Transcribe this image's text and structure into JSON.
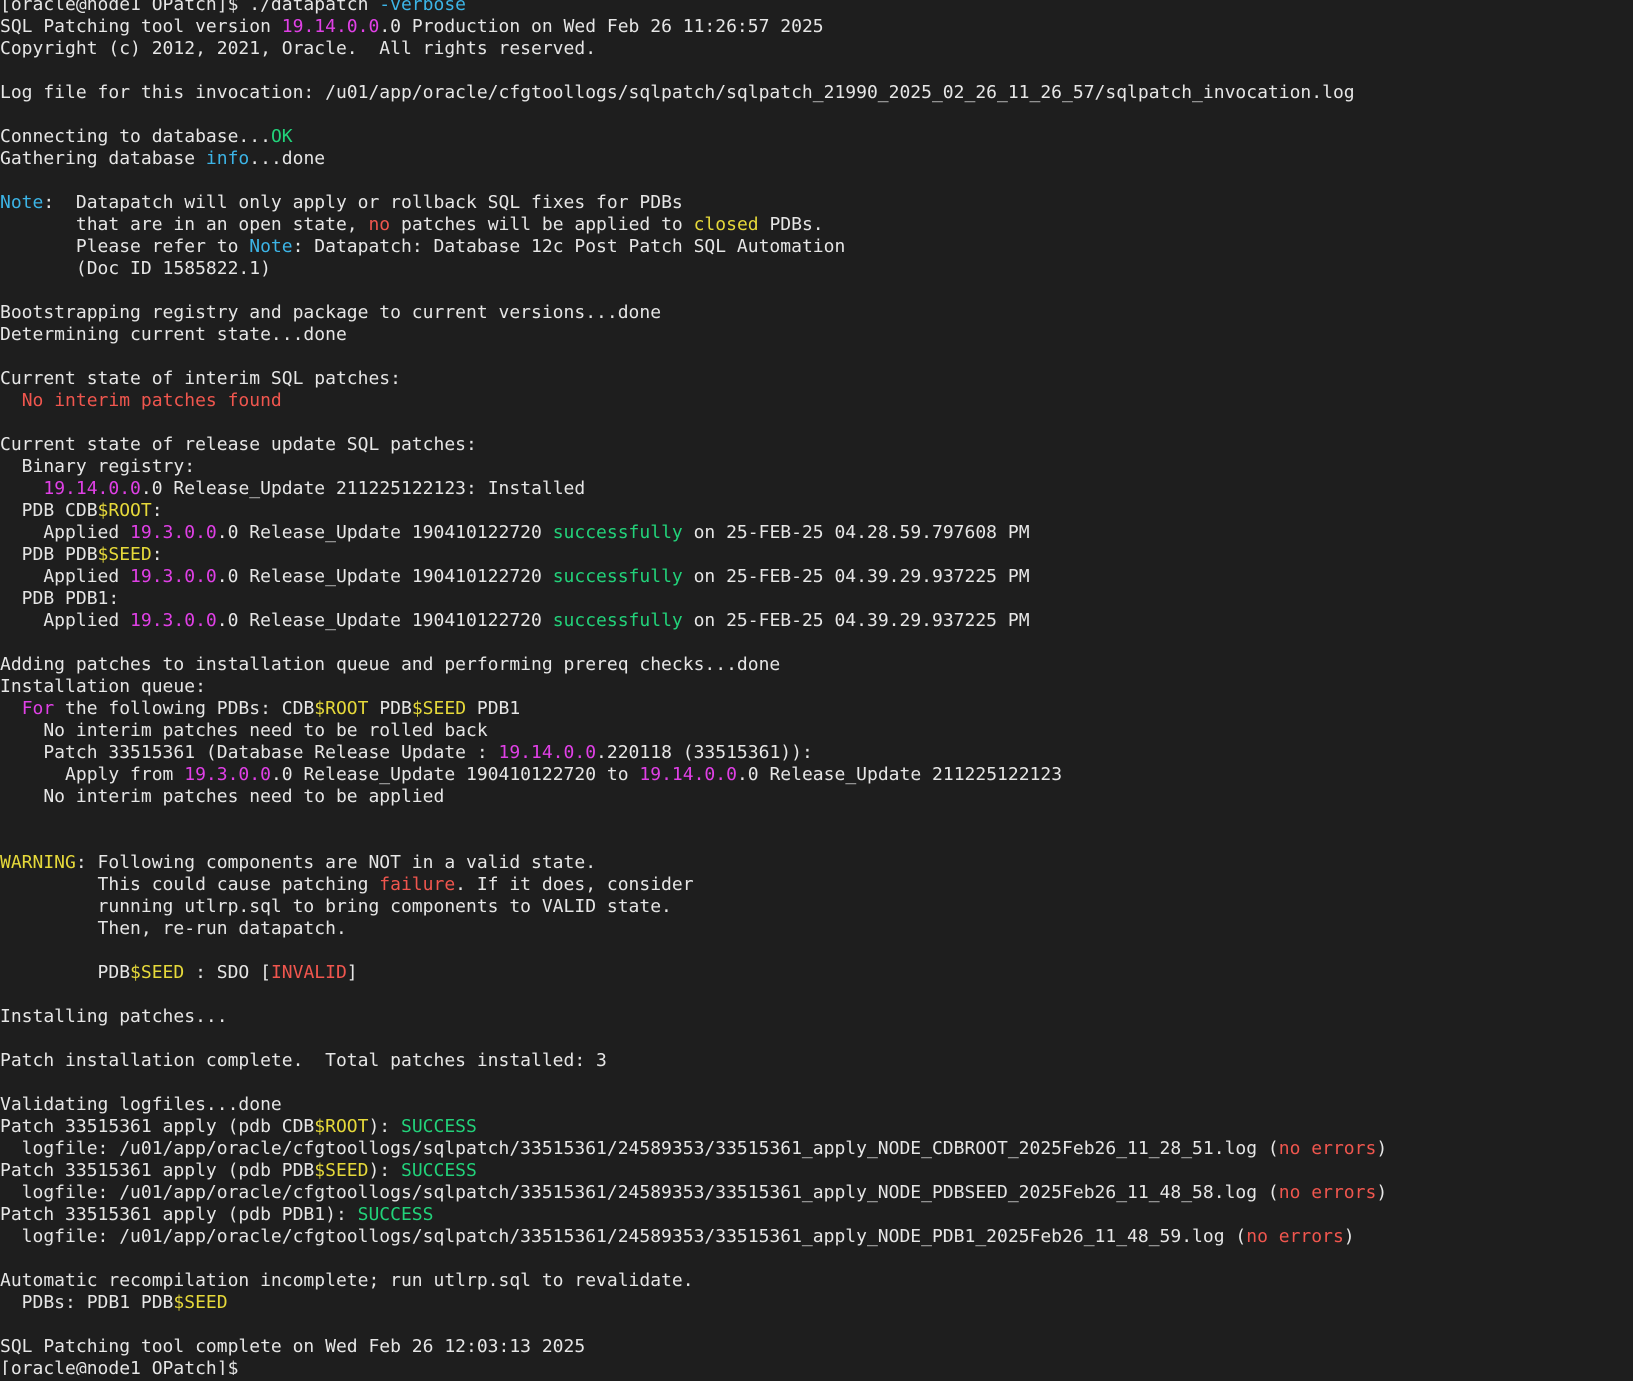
{
  "window": {
    "title": "Terminal - datapatch -verbose"
  },
  "palette": {
    "background": "#1e1e1e",
    "default": "#e6e6e6",
    "magenta": "#e040e6",
    "cyan": "#3cb4e6",
    "green": "#22d27a",
    "yellow": "#e6d93a",
    "red": "#f0564e"
  },
  "lines": [
    [
      [
        "[oracle@node1 OPatch]$ ./datapatch ",
        "default"
      ],
      [
        "-verbose",
        "cyan"
      ]
    ],
    [
      [
        "SQL Patching tool version ",
        "default"
      ],
      [
        "19.14.0.0",
        "magenta"
      ],
      [
        ".0 Production on Wed Feb 26 11:26:57 2025",
        "default"
      ]
    ],
    [
      [
        "Copyright (c) 2012, 2021, Oracle.  All rights reserved.",
        "default"
      ]
    ],
    [
      [
        "",
        "default"
      ]
    ],
    [
      [
        "Log file for this invocation: /u01/app/oracle/cfgtoollogs/sqlpatch/sqlpatch_21990_2025_02_26_11_26_57/sqlpatch_invocation.log",
        "default"
      ]
    ],
    [
      [
        "",
        "default"
      ]
    ],
    [
      [
        "Connecting to database...",
        "default"
      ],
      [
        "OK",
        "green"
      ]
    ],
    [
      [
        "Gathering database ",
        "default"
      ],
      [
        "info",
        "cyan"
      ],
      [
        "...done",
        "default"
      ]
    ],
    [
      [
        "",
        "default"
      ]
    ],
    [
      [
        "Note",
        "cyan"
      ],
      [
        ":  Datapatch will only apply or rollback SQL fixes for PDBs",
        "default"
      ]
    ],
    [
      [
        "       that are in an open state, ",
        "default"
      ],
      [
        "no",
        "red"
      ],
      [
        " patches will be applied to ",
        "default"
      ],
      [
        "closed",
        "yellow"
      ],
      [
        " PDBs.",
        "default"
      ]
    ],
    [
      [
        "       Please refer to ",
        "default"
      ],
      [
        "Note",
        "cyan"
      ],
      [
        ": Datapatch: Database 12c Post Patch SQL Automation",
        "default"
      ]
    ],
    [
      [
        "       (Doc ID 1585822.1)",
        "default"
      ]
    ],
    [
      [
        "",
        "default"
      ]
    ],
    [
      [
        "Bootstrapping registry and package to current versions...done",
        "default"
      ]
    ],
    [
      [
        "Determining current state...done",
        "default"
      ]
    ],
    [
      [
        "",
        "default"
      ]
    ],
    [
      [
        "Current state of interim SQL patches:",
        "default"
      ]
    ],
    [
      [
        "  ",
        "default"
      ],
      [
        "No interim patches found",
        "red"
      ]
    ],
    [
      [
        "",
        "default"
      ]
    ],
    [
      [
        "Current state of release update SQL patches:",
        "default"
      ]
    ],
    [
      [
        "  Binary registry:",
        "default"
      ]
    ],
    [
      [
        "    ",
        "default"
      ],
      [
        "19.14.0.0",
        "magenta"
      ],
      [
        ".0 Release_Update 211225122123: Installed",
        "default"
      ]
    ],
    [
      [
        "  PDB CDB",
        "default"
      ],
      [
        "$ROOT",
        "yellow"
      ],
      [
        ":",
        "default"
      ]
    ],
    [
      [
        "    Applied ",
        "default"
      ],
      [
        "19.3.0.0",
        "magenta"
      ],
      [
        ".0 Release_Update 190410122720 ",
        "default"
      ],
      [
        "successfully",
        "green"
      ],
      [
        " on 25-FEB-25 04.28.59.797608 PM",
        "default"
      ]
    ],
    [
      [
        "  PDB PDB",
        "default"
      ],
      [
        "$SEED",
        "yellow"
      ],
      [
        ":",
        "default"
      ]
    ],
    [
      [
        "    Applied ",
        "default"
      ],
      [
        "19.3.0.0",
        "magenta"
      ],
      [
        ".0 Release_Update 190410122720 ",
        "default"
      ],
      [
        "successfully",
        "green"
      ],
      [
        " on 25-FEB-25 04.39.29.937225 PM",
        "default"
      ]
    ],
    [
      [
        "  PDB PDB1:",
        "default"
      ]
    ],
    [
      [
        "    Applied ",
        "default"
      ],
      [
        "19.3.0.0",
        "magenta"
      ],
      [
        ".0 Release_Update 190410122720 ",
        "default"
      ],
      [
        "successfully",
        "green"
      ],
      [
        " on 25-FEB-25 04.39.29.937225 PM",
        "default"
      ]
    ],
    [
      [
        "",
        "default"
      ]
    ],
    [
      [
        "Adding patches to installation queue and performing prereq checks...done",
        "default"
      ]
    ],
    [
      [
        "Installation queue:",
        "default"
      ]
    ],
    [
      [
        "  ",
        "default"
      ],
      [
        "For",
        "magenta"
      ],
      [
        " the following PDBs: CDB",
        "default"
      ],
      [
        "$ROOT",
        "yellow"
      ],
      [
        " PDB",
        "default"
      ],
      [
        "$SEED",
        "yellow"
      ],
      [
        " PDB1",
        "default"
      ]
    ],
    [
      [
        "    No interim patches need to be rolled back",
        "default"
      ]
    ],
    [
      [
        "    Patch 33515361 (Database Release Update : ",
        "default"
      ],
      [
        "19.14.0.0",
        "magenta"
      ],
      [
        ".220118 (33515361)):",
        "default"
      ]
    ],
    [
      [
        "      Apply from ",
        "default"
      ],
      [
        "19.3.0.0",
        "magenta"
      ],
      [
        ".0 Release_Update 190410122720 to ",
        "default"
      ],
      [
        "19.14.0.0",
        "magenta"
      ],
      [
        ".0 Release_Update 211225122123",
        "default"
      ]
    ],
    [
      [
        "    No interim patches need to be applied",
        "default"
      ]
    ],
    [
      [
        "",
        "default"
      ]
    ],
    [
      [
        "",
        "default"
      ]
    ],
    [
      [
        "WARNING",
        "yellow"
      ],
      [
        ": Following components are NOT in a valid state.",
        "default"
      ]
    ],
    [
      [
        "         This could cause patching ",
        "default"
      ],
      [
        "failure",
        "red"
      ],
      [
        ". If it does, consider",
        "default"
      ]
    ],
    [
      [
        "         running utlrp.sql to bring components to VALID state.",
        "default"
      ]
    ],
    [
      [
        "         Then, re-run datapatch.",
        "default"
      ]
    ],
    [
      [
        "",
        "default"
      ]
    ],
    [
      [
        "         PDB",
        "default"
      ],
      [
        "$SEED",
        "yellow"
      ],
      [
        " : SDO [",
        "default"
      ],
      [
        "INVALID",
        "red"
      ],
      [
        "]",
        "default"
      ]
    ],
    [
      [
        "",
        "default"
      ]
    ],
    [
      [
        "Installing patches...",
        "default"
      ]
    ],
    [
      [
        "",
        "default"
      ]
    ],
    [
      [
        "Patch installation complete.  Total patches installed: 3",
        "default"
      ]
    ],
    [
      [
        "",
        "default"
      ]
    ],
    [
      [
        "Validating logfiles...done",
        "default"
      ]
    ],
    [
      [
        "Patch 33515361 apply (pdb CDB",
        "default"
      ],
      [
        "$ROOT",
        "yellow"
      ],
      [
        "): ",
        "default"
      ],
      [
        "SUCCESS",
        "green"
      ]
    ],
    [
      [
        "  logfile: /u01/app/oracle/cfgtoollogs/sqlpatch/33515361/24589353/33515361_apply_NODE_CDBROOT_2025Feb26_11_28_51.log (",
        "default"
      ],
      [
        "no errors",
        "red"
      ],
      [
        ")",
        "default"
      ]
    ],
    [
      [
        "Patch 33515361 apply (pdb PDB",
        "default"
      ],
      [
        "$SEED",
        "yellow"
      ],
      [
        "): ",
        "default"
      ],
      [
        "SUCCESS",
        "green"
      ]
    ],
    [
      [
        "  logfile: /u01/app/oracle/cfgtoollogs/sqlpatch/33515361/24589353/33515361_apply_NODE_PDBSEED_2025Feb26_11_48_58.log (",
        "default"
      ],
      [
        "no errors",
        "red"
      ],
      [
        ")",
        "default"
      ]
    ],
    [
      [
        "Patch 33515361 apply (pdb PDB1): ",
        "default"
      ],
      [
        "SUCCESS",
        "green"
      ]
    ],
    [
      [
        "  logfile: /u01/app/oracle/cfgtoollogs/sqlpatch/33515361/24589353/33515361_apply_NODE_PDB1_2025Feb26_11_48_59.log (",
        "default"
      ],
      [
        "no errors",
        "red"
      ],
      [
        ")",
        "default"
      ]
    ],
    [
      [
        "",
        "default"
      ]
    ],
    [
      [
        "Automatic recompilation incomplete; run utlrp.sql to revalidate.",
        "default"
      ]
    ],
    [
      [
        "  PDBs: PDB1 PDB",
        "default"
      ],
      [
        "$SEED",
        "yellow"
      ]
    ],
    [
      [
        "",
        "default"
      ]
    ],
    [
      [
        "SQL Patching tool complete on Wed Feb 26 12:03:13 2025",
        "default"
      ]
    ],
    [
      [
        "[oracle@node1 OPatch]$ ",
        "default"
      ]
    ]
  ]
}
